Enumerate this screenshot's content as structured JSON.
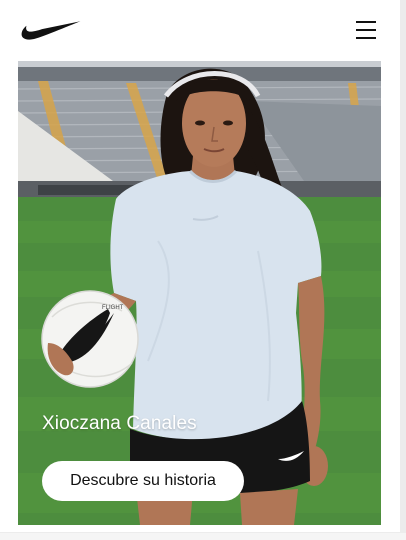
{
  "header": {
    "logo_icon": "nike-swoosh-icon",
    "menu_icon": "hamburger-menu-icon"
  },
  "hero": {
    "athlete_name": "Xioczana Canales",
    "cta_label": "Descubre su historia"
  },
  "colors": {
    "text_dark": "#111111",
    "pitch_green": "#4a8a3c",
    "stadium_grey": "#8a8f96",
    "shirt_light_blue": "#d6e2ee",
    "shorts_black": "#151515"
  }
}
